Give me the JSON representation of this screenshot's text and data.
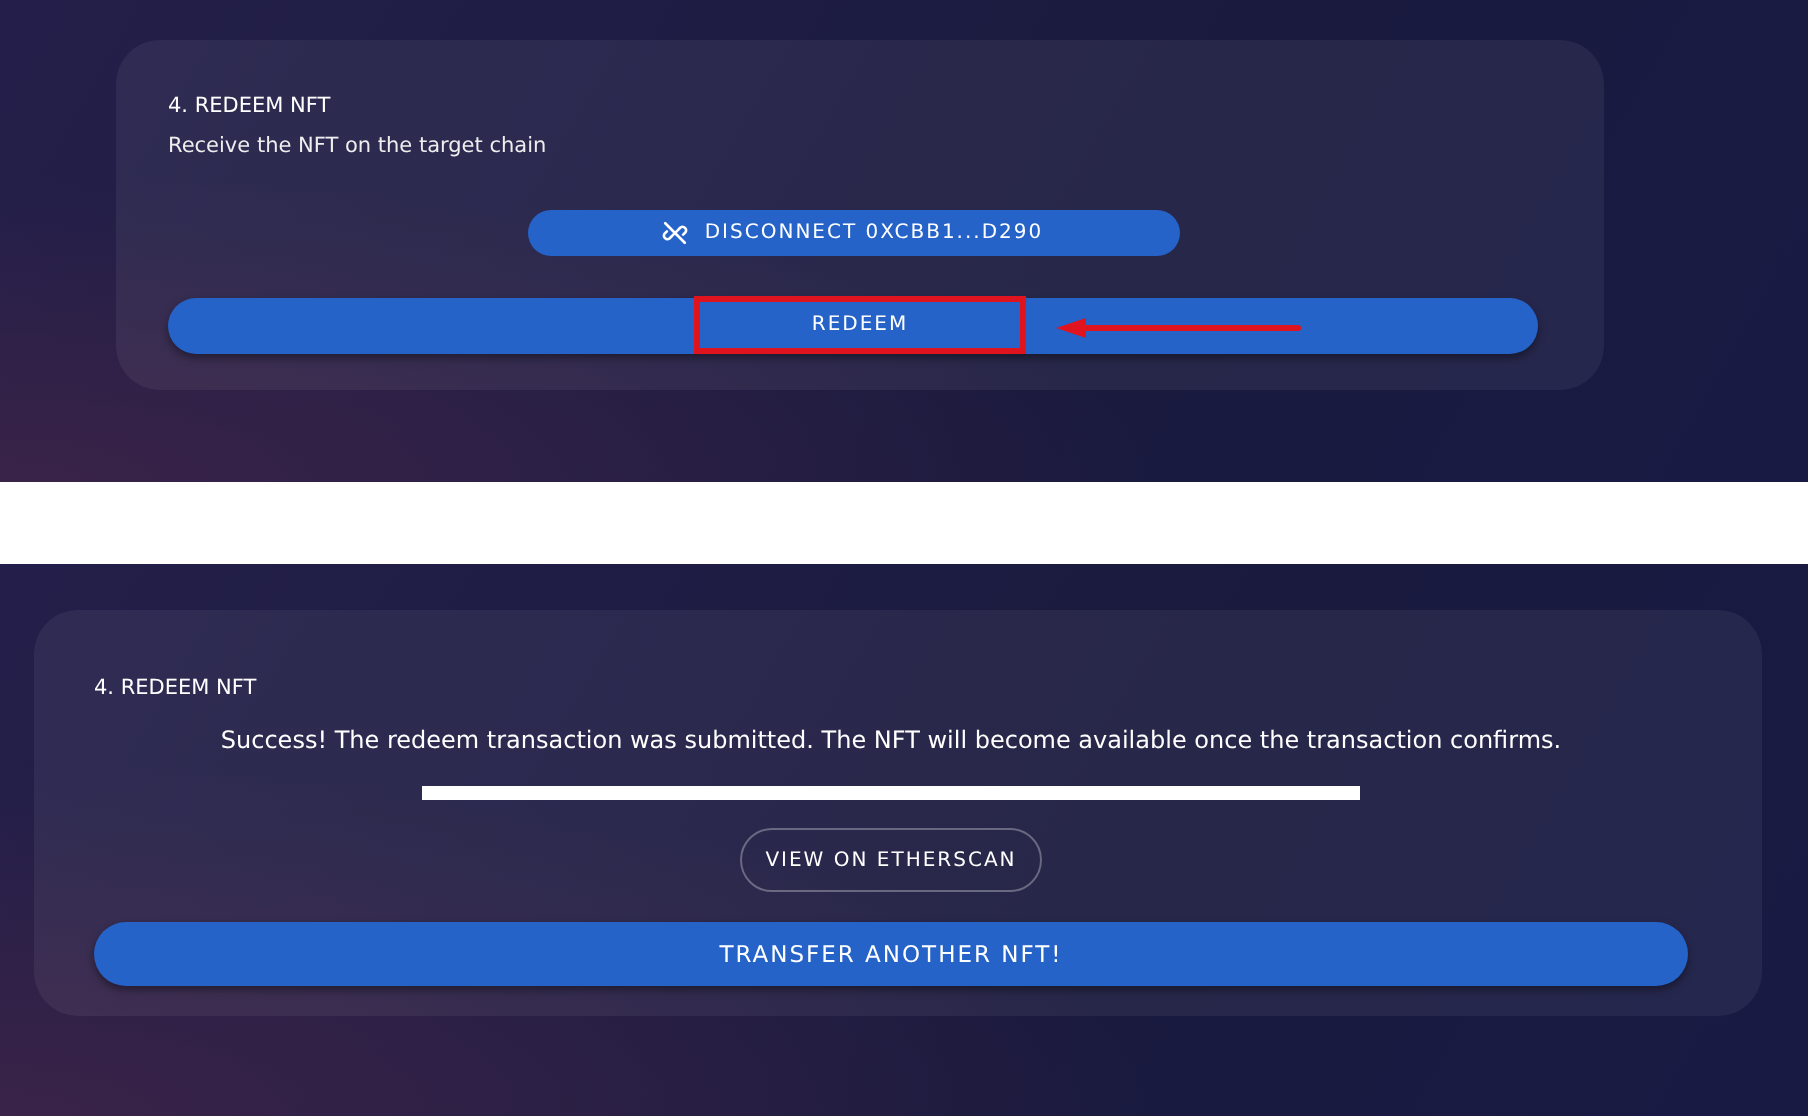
{
  "panels": [
    {
      "kind": "step",
      "title": "4. REDEEM NFT",
      "subtitle": "Receive the NFT on the target chain",
      "disconnect_button": "DISCONNECT 0XCBB1...D290",
      "action_button": "REDEEM",
      "highlighted": true
    },
    {
      "kind": "success",
      "title": "4. REDEEM NFT",
      "message": "Success! The redeem transaction was submitted. The NFT will become available once the transaction confirms.",
      "link_button": "VIEW ON ETHERSCAN",
      "action_button": "TRANSFER ANOTHER NFT!",
      "highlighted": false
    }
  ]
}
